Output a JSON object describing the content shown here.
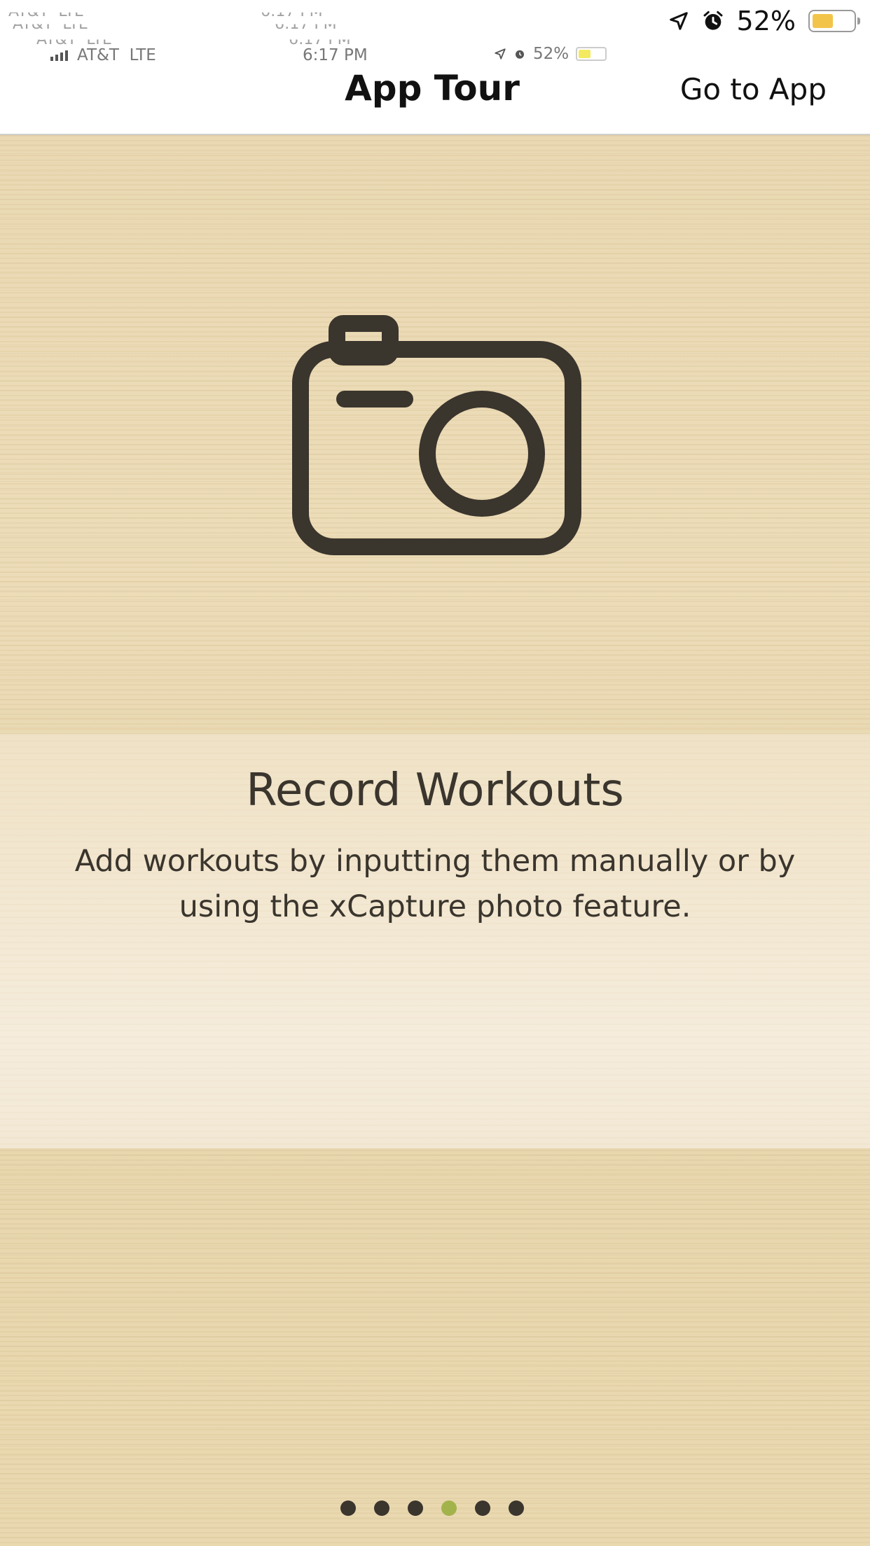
{
  "status_bar": {
    "carrier": "AT&T",
    "network": "LTE",
    "time": "6:17 PM",
    "battery_percent": "52%",
    "battery_level": 0.52,
    "icons": [
      "signal-bars-icon",
      "location-arrow-icon",
      "alarm-clock-icon",
      "battery-icon"
    ]
  },
  "nav": {
    "title": "App Tour",
    "action_label": "Go to App"
  },
  "slide": {
    "icon": "camera-icon",
    "title": "Record Workouts",
    "description": "Add workouts by inputting them manually or by using the xCapture photo feature."
  },
  "pager": {
    "total": 6,
    "current": 4
  },
  "colors": {
    "ink": "#3a352d",
    "active_dot": "#a3b34b",
    "battery_fill": "#f2c44a",
    "wood_light": "#f3e8d3",
    "wood": "#ead9b3"
  }
}
